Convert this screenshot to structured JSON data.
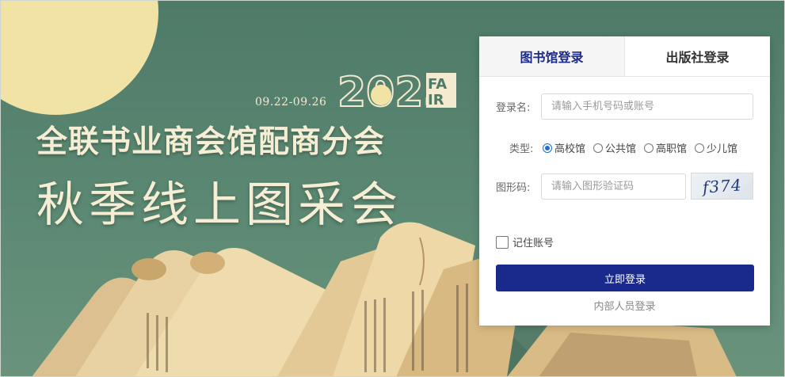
{
  "banner": {
    "dates": "09.22-09.26",
    "year": "2025",
    "brand": "FAIR",
    "title_line1": "全联书业商会馆配商分会",
    "title_line2": "秋季线上图采会"
  },
  "login": {
    "tabs": [
      {
        "label": "图书馆登录",
        "active": true
      },
      {
        "label": "出版社登录",
        "active": false
      }
    ],
    "username": {
      "label": "登录名:",
      "value": "",
      "placeholder": "请输入手机号码或账号"
    },
    "type": {
      "label": "类型:",
      "options": [
        {
          "label": "高校馆",
          "checked": true
        },
        {
          "label": "公共馆",
          "checked": false
        },
        {
          "label": "高职馆",
          "checked": false
        },
        {
          "label": "少儿馆",
          "checked": false
        }
      ]
    },
    "captcha": {
      "label": "图形码:",
      "value": "",
      "placeholder": "请输入图形验证码",
      "image_text": "f374"
    },
    "remember": {
      "label": "记住账号",
      "checked": false
    },
    "submit_label": "立即登录",
    "internal_link": "内部人员登录"
  },
  "colors": {
    "accent": "#1a2a8c",
    "tab_active_text": "#1c2a8a",
    "banner_green": "#5d8a74",
    "sun": "#f1e3a6",
    "paper": "#e9d3a4"
  },
  "icons": [
    "radio-icon",
    "checkbox-icon",
    "captcha-image"
  ]
}
